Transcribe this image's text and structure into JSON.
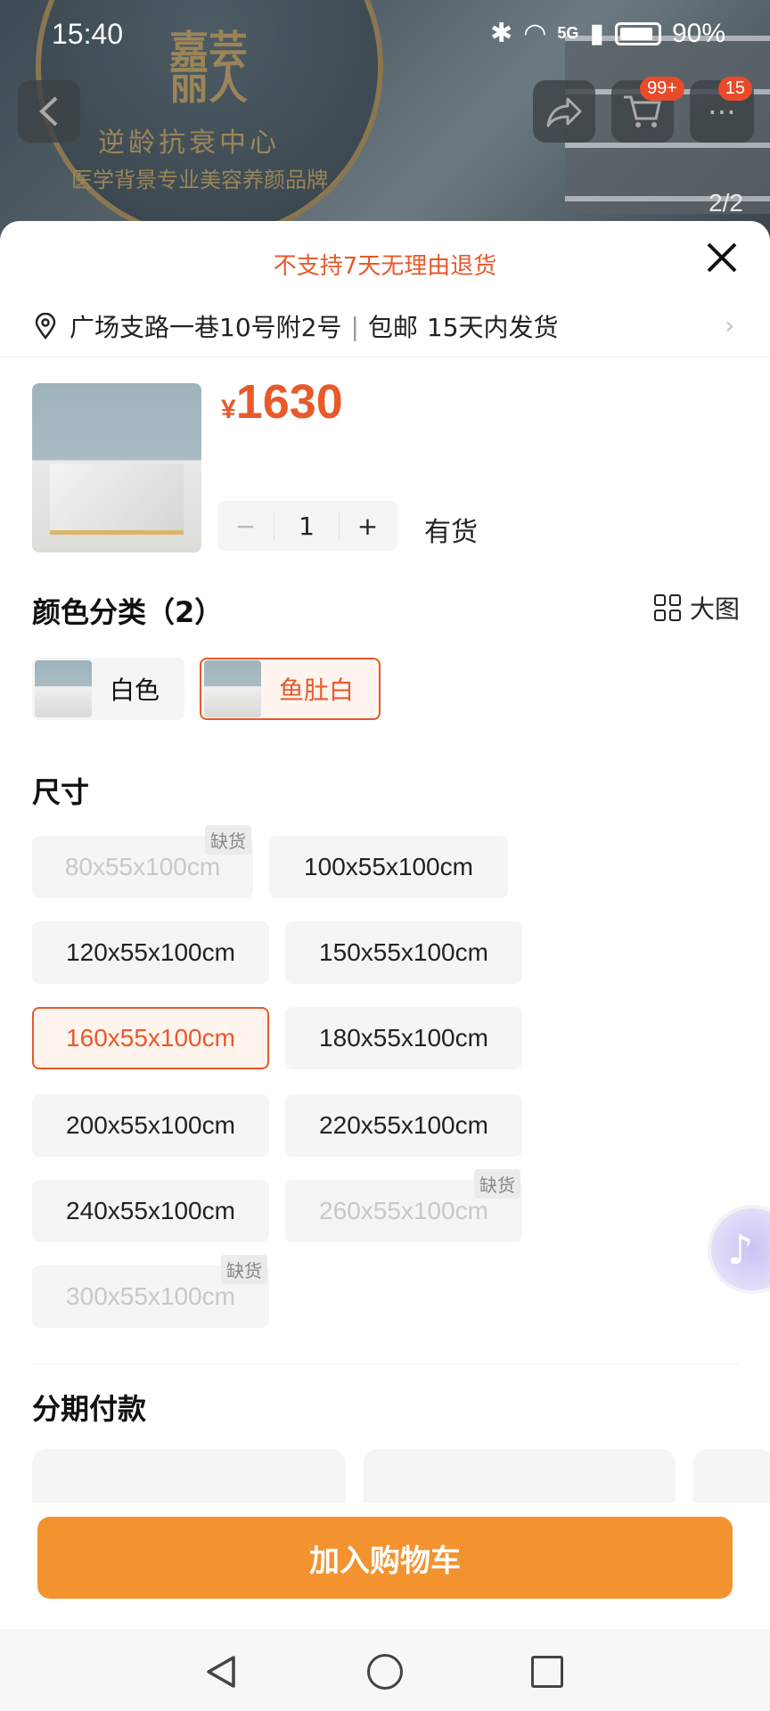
{
  "status_bar": {
    "time": "15:40",
    "signal": "5G",
    "battery": "90%"
  },
  "header": {
    "cart_badge": "99+",
    "msg_badge": "15",
    "pager": "2/2",
    "hero_sign": {
      "line1": "嘉芸",
      "line2": "丽人",
      "line3": "逆龄抗衰中心",
      "line4": "医学背景专业美容养颜品牌"
    }
  },
  "sheet": {
    "notice": "不支持7天无理由退货",
    "address": "广场支路一巷10号附2号",
    "shipping": "包邮",
    "delivery": "15天内发货",
    "price_currency": "¥",
    "price": "1630",
    "quantity": "1",
    "stock": "有货",
    "color_section_title": "颜色分类（2）",
    "big_view_label": "大图",
    "colors": [
      {
        "label": "白色",
        "selected": false
      },
      {
        "label": "鱼肚白",
        "selected": true
      }
    ],
    "size_section_title": "尺寸",
    "out_of_stock_label": "缺货",
    "sizes": [
      {
        "label": "80x55x100cm",
        "state": "unavailable"
      },
      {
        "label": "100x55x100cm",
        "state": "available"
      },
      {
        "label": "120x55x100cm",
        "state": "available"
      },
      {
        "label": "150x55x100cm",
        "state": "available"
      },
      {
        "label": "160x55x100cm",
        "state": "selected"
      },
      {
        "label": "180x55x100cm",
        "state": "available"
      },
      {
        "label": "200x55x100cm",
        "state": "available"
      },
      {
        "label": "220x55x100cm",
        "state": "available"
      },
      {
        "label": "240x55x100cm",
        "state": "available"
      },
      {
        "label": "260x55x100cm",
        "state": "unavailable"
      },
      {
        "label": "300x55x100cm",
        "state": "unavailable"
      }
    ],
    "installment_title": "分期付款",
    "add_to_cart": "加入购物车"
  },
  "colors": {
    "accent": "#e8592b",
    "button": "#f39330"
  }
}
